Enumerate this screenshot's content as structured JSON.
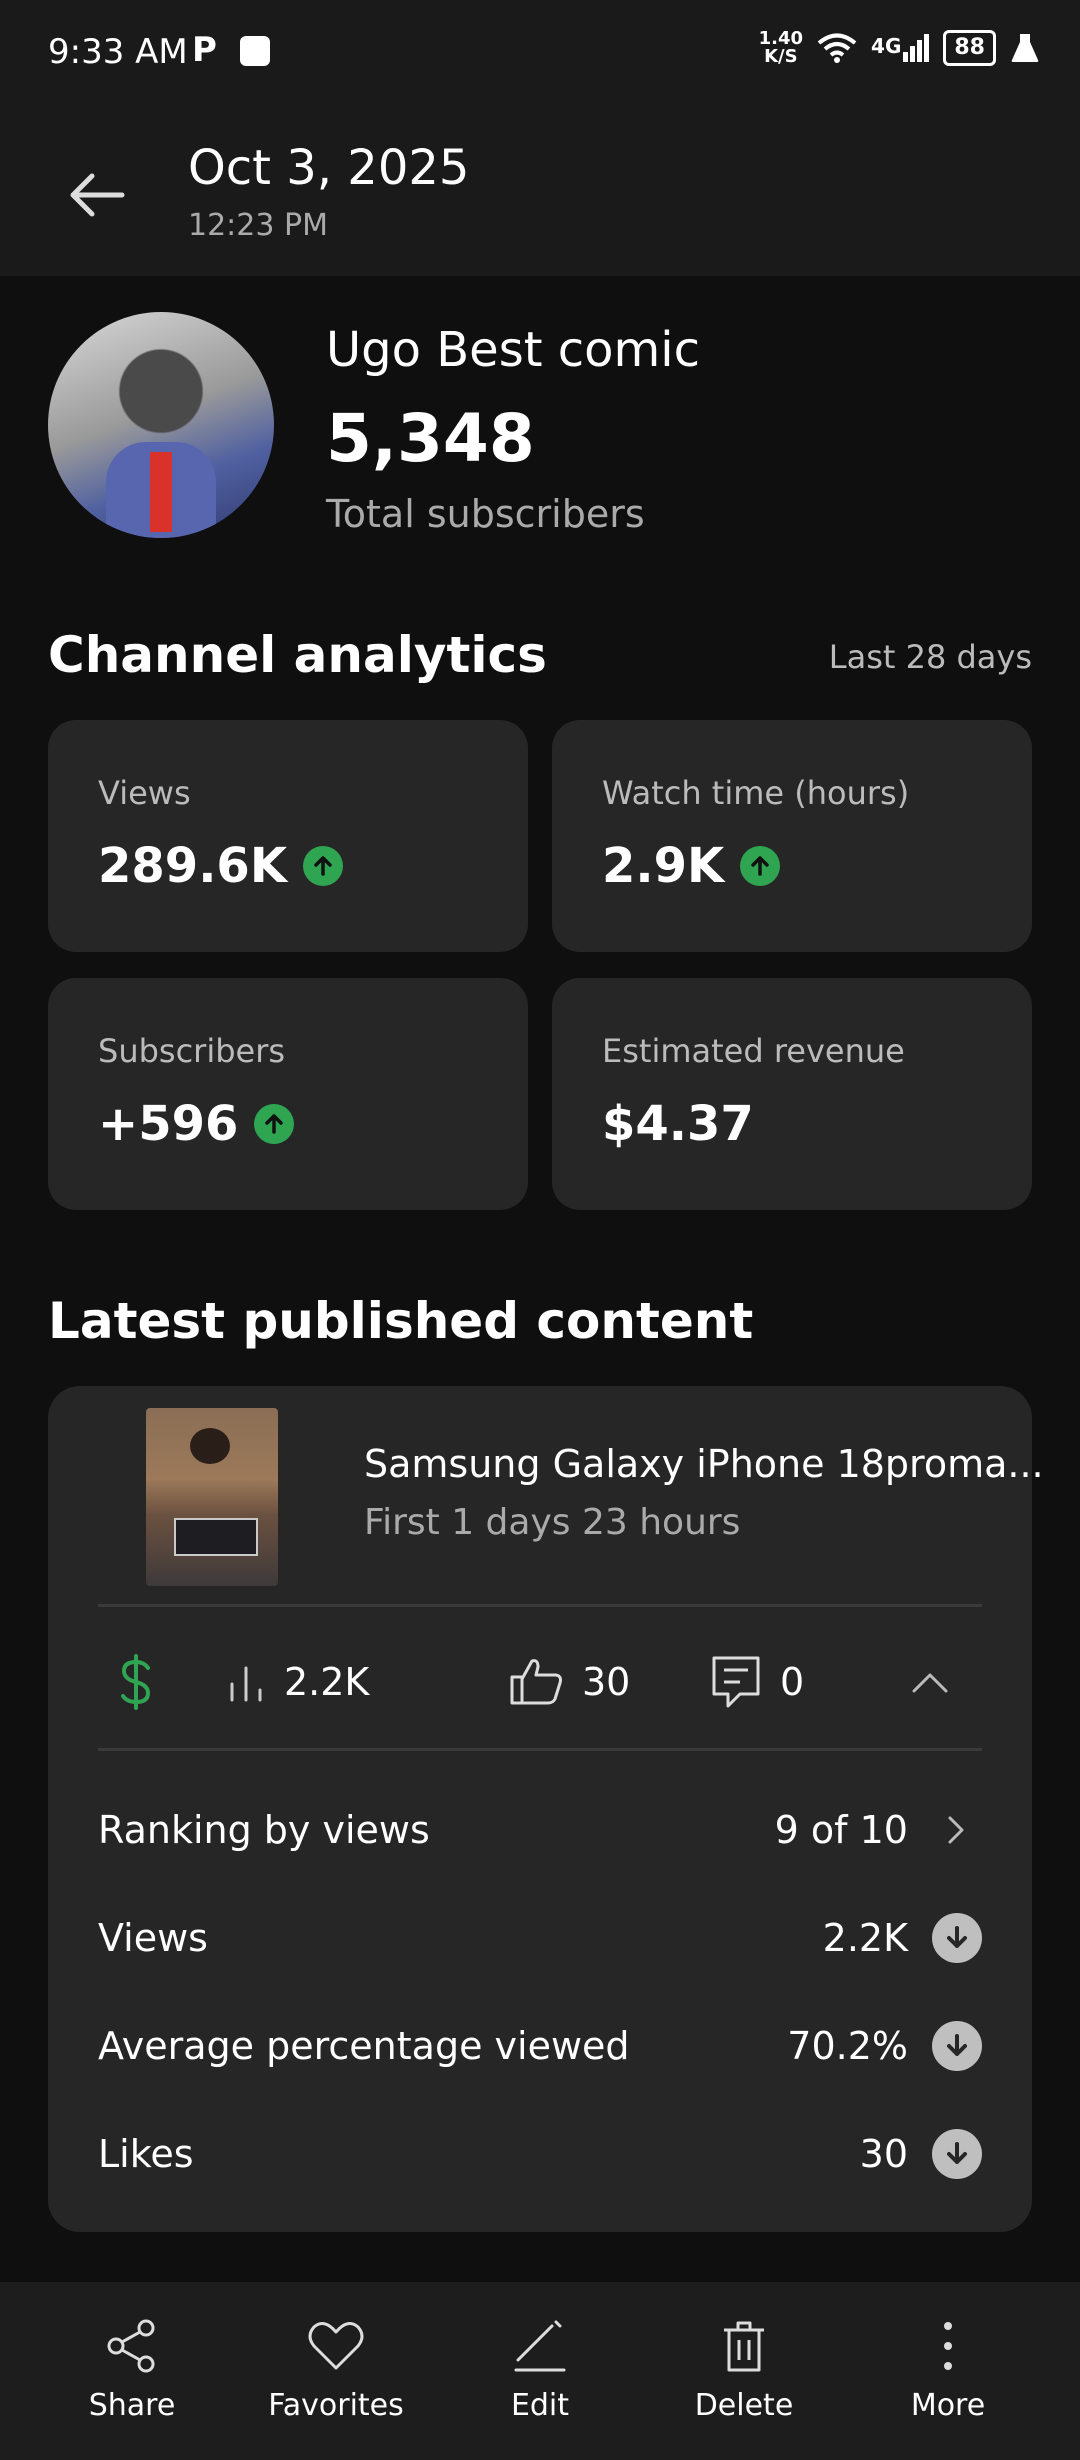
{
  "status_bar": {
    "time": "9:33 AM",
    "app_letter": "P",
    "net_speed_top": "1.40",
    "net_speed_unit": "K/S",
    "signal": "4G",
    "battery": "88"
  },
  "header": {
    "date": "Oct 3, 2025",
    "time": "12:23 PM"
  },
  "channel": {
    "name": "Ugo Best comic",
    "subscribers": "5,348",
    "subscribers_label": "Total subscribers"
  },
  "analytics": {
    "title": "Channel analytics",
    "period": "Last 28 days",
    "cards": [
      {
        "label": "Views",
        "value": "289.6K",
        "trend": "up"
      },
      {
        "label": "Watch time (hours)",
        "value": "2.9K",
        "trend": "up"
      },
      {
        "label": "Subscribers",
        "value": "+596",
        "trend": "up"
      },
      {
        "label": "Estimated revenue",
        "value": "$4.37",
        "trend": "none"
      }
    ]
  },
  "latest": {
    "title": "Latest published content",
    "video_title": "Samsung Galaxy iPhone 18proma...",
    "video_sub": "First 1 days 23 hours",
    "stats": {
      "views": "2.2K",
      "likes": "30",
      "comments": "0"
    },
    "rows": [
      {
        "label": "Ranking by views",
        "value": "9 of 10",
        "icon": "chevron-right-icon"
      },
      {
        "label": "Views",
        "value": "2.2K",
        "icon": "arrow-down-icon"
      },
      {
        "label": "Average percentage viewed",
        "value": "70.2%",
        "icon": "arrow-down-icon"
      },
      {
        "label": "Likes",
        "value": "30",
        "icon": "arrow-down-icon"
      }
    ]
  },
  "bottom_nav": [
    {
      "label": "Share",
      "icon": "share-icon"
    },
    {
      "label": "Favorites",
      "icon": "heart-icon"
    },
    {
      "label": "Edit",
      "icon": "edit-icon"
    },
    {
      "label": "Delete",
      "icon": "trash-icon"
    },
    {
      "label": "More",
      "icon": "more-vertical-icon"
    }
  ],
  "colors": {
    "background": "#0f0f0f",
    "card": "#262626",
    "trend_up": "#2fa552",
    "revenue": "#2fa552"
  }
}
